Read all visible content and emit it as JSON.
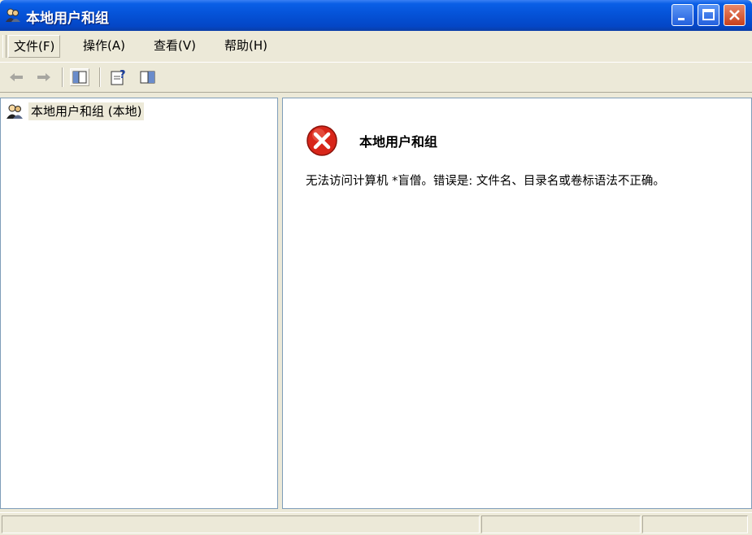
{
  "window": {
    "title": "本地用户和组",
    "icon": "users-groups-icon"
  },
  "menubar": {
    "items": [
      {
        "label": "文件(F)"
      },
      {
        "label": "操作(A)"
      },
      {
        "label": "查看(V)"
      },
      {
        "label": "帮助(H)"
      }
    ]
  },
  "toolbar": {
    "buttons": [
      "back-icon",
      "forward-icon",
      "show-hide-tree-icon",
      "help-icon",
      "show-hide-action-pane-icon"
    ]
  },
  "tree": {
    "root_label": "本地用户和组 (本地)",
    "root_icon": "users-groups-icon"
  },
  "error": {
    "title": "本地用户和组",
    "message": "无法访问计算机 *盲僧。错误是: 文件名、目录名或卷标语法不正确。",
    "icon": "error-icon",
    "color": "#d8261a"
  },
  "statusbar": {
    "cells": [
      "",
      "",
      ""
    ]
  }
}
